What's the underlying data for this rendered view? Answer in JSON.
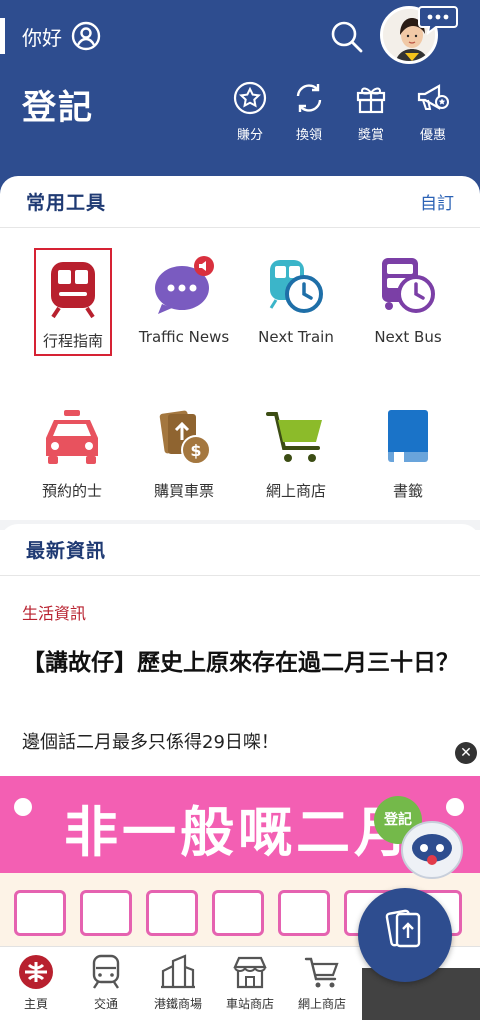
{
  "header": {
    "greeting": "你好",
    "title": "登記",
    "actions": [
      {
        "label": "賺分",
        "icon": "star-circle-icon"
      },
      {
        "label": "換領",
        "icon": "exchange-icon"
      },
      {
        "label": "獎賞",
        "icon": "gift-icon"
      },
      {
        "label": "優惠",
        "icon": "megaphone-icon"
      }
    ]
  },
  "tools": {
    "title": "常用工具",
    "customise": "自訂",
    "items": [
      {
        "label": "行程指南",
        "icon": "train-icon"
      },
      {
        "label": "Traffic News",
        "icon": "chat-bubble-icon"
      },
      {
        "label": "Next Train",
        "icon": "train-clock-icon"
      },
      {
        "label": "Next Bus",
        "icon": "bus-clock-icon"
      },
      {
        "label": "預約的士",
        "icon": "taxi-icon"
      },
      {
        "label": "購買車票",
        "icon": "ticket-icon"
      },
      {
        "label": "網上商店",
        "icon": "shopping-cart-icon"
      },
      {
        "label": "書籤",
        "icon": "bookmark-icon"
      }
    ]
  },
  "news": {
    "title": "最新資訊",
    "category": "生活資訊",
    "headline": "【講故仔】歷史上原來存在過二月三十日？",
    "summary": "邊個話二月最多只係得29日㗎！"
  },
  "banner": {
    "text": "非一般嘅二月",
    "badge": "登記"
  },
  "nav": {
    "items": [
      {
        "label": "主頁",
        "icon": "mtr-logo-icon"
      },
      {
        "label": "交通",
        "icon": "train-icon"
      },
      {
        "label": "港鐵商場",
        "icon": "building-icon"
      },
      {
        "label": "車站商店",
        "icon": "shop-icon"
      },
      {
        "label": "網上商店",
        "icon": "shopping-cart-icon"
      }
    ]
  },
  "colors": {
    "brand_blue": "#2e4d8f",
    "mtr_red": "#b8202e",
    "banner_pink": "#f35fb3"
  }
}
